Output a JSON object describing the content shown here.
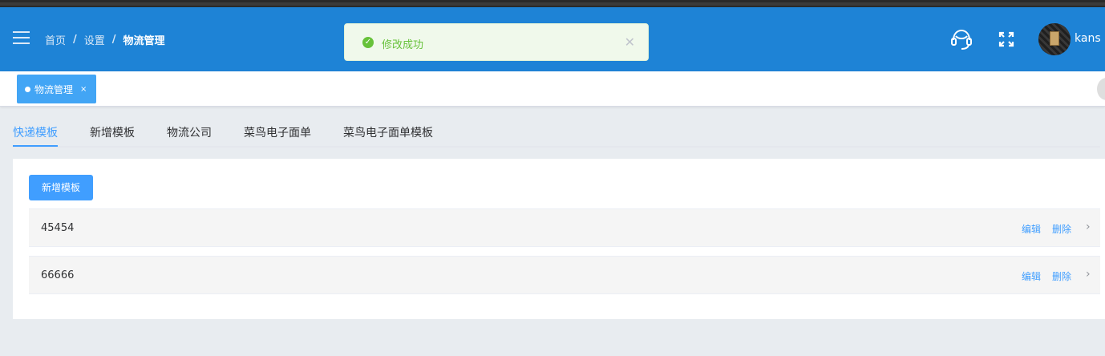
{
  "breadcrumb": {
    "home": "首页",
    "settings": "设置",
    "current": "物流管理",
    "sep": "/"
  },
  "toast": {
    "message": "修改成功",
    "close": "✕",
    "check": "✓"
  },
  "user": {
    "name": "kans"
  },
  "tags_bar": {
    "active_tag": "物流管理",
    "close": "×"
  },
  "tabs": [
    "快递模板",
    "新增模板",
    "物流公司",
    "菜鸟电子面单",
    "菜鸟电子面单模板"
  ],
  "active_tab_index": 0,
  "content": {
    "add_button": "新增模板",
    "templates": [
      {
        "name": "45454",
        "edit": "编辑",
        "delete": "删除"
      },
      {
        "name": "66666",
        "edit": "编辑",
        "delete": "删除"
      }
    ],
    "row_arrow": "›"
  },
  "colors": {
    "header": "#1e83d6",
    "accent": "#409eff",
    "success": "#67c23a",
    "tag": "#42a5f5"
  },
  "icons": [
    "menu-icon",
    "success-check-icon",
    "close-icon",
    "headset-support-icon",
    "fullscreen-icon",
    "avatar",
    "tag-dot-icon",
    "chevron-right-icon"
  ]
}
